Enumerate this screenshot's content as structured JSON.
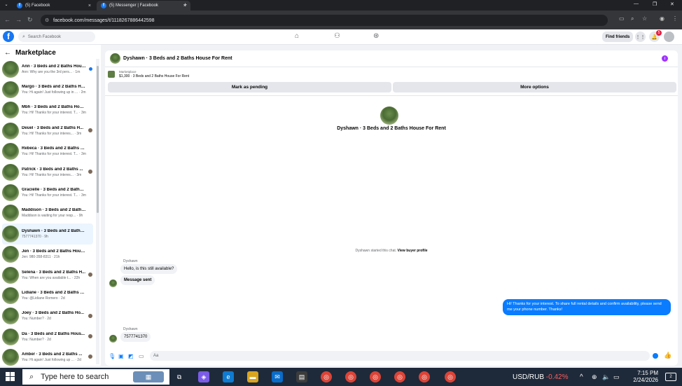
{
  "browser": {
    "tabs": [
      {
        "title": "(5) Facebook",
        "active": false
      },
      {
        "title": "(5) Messenger | Facebook",
        "active": true
      }
    ],
    "url": "facebook.com/messages/t/1118267886442598"
  },
  "fb_header": {
    "search_placeholder": "Search Facebook",
    "find_friends": "Find friends",
    "notification_count": "5"
  },
  "sidebar": {
    "title": "Marketplace",
    "conversations": [
      {
        "name": "Ann · 3 Beds and 2 Baths Hous...",
        "preview": "Ann: Why are you the 3rd pers... · 1m",
        "status": "unread"
      },
      {
        "name": "Margo · 3 Beds and 2 Baths Ho...",
        "preview": "You: Hi again! Just following up in ... · 2m",
        "status": ""
      },
      {
        "name": "Mbh · 3 Beds and 2 Baths Hous...",
        "preview": "You: Hi! Thanks for your interest. T... · 3m",
        "status": ""
      },
      {
        "name": "Deuel · 3 Beds and 2 Baths H...",
        "preview": "You: Hi! Thanks for your interes... · 3m",
        "status": "seen"
      },
      {
        "name": "Rebeca · 3 Beds and 2 Baths Ho...",
        "preview": "You: Hi! Thanks for your interest. T... · 3m",
        "status": ""
      },
      {
        "name": "Patrick · 3 Beds and 2 Baths ...",
        "preview": "You: Hi! Thanks for your interes... · 3m",
        "status": "seen"
      },
      {
        "name": "Gracielle · 3 Beds and 2 Baths H...",
        "preview": "You: Hi! Thanks for your interest. T... · 3m",
        "status": ""
      },
      {
        "name": "Maddison · 3 Beds and 2 Baths ...",
        "preview": "Maddison is waiting for your resp... · 9h",
        "status": ""
      },
      {
        "name": "Dyshawn · 3 Beds and 2 Baths ...",
        "preview": "7577741370 · 9h",
        "status": "active"
      },
      {
        "name": "Jen · 3 Beds and 2 Baths House ...",
        "preview": "Jen: 980-358-8311 · 21h",
        "status": ""
      },
      {
        "name": "Selena · 3 Beds and 2 Baths H...",
        "preview": "You: When are you available t... · 22h",
        "status": "seen"
      },
      {
        "name": "Lidiane · 3 Beds and 2 Baths Ho...",
        "preview": "You: @Lidiane Romero · 2d",
        "status": ""
      },
      {
        "name": "Joey · 3 Beds and 2 Baths Ho...",
        "preview": "You: Number? · 2d",
        "status": "seen"
      },
      {
        "name": "Da · 3 Beds and 2 Baths Hous...",
        "preview": "You: Number? · 2d",
        "status": "seen"
      },
      {
        "name": "Amber · 3 Beds and 2 Baths ...",
        "preview": "You: Hi again! Just following up ... · 2d",
        "status": "seen"
      }
    ]
  },
  "chat": {
    "title": "Dyshawn · 3 Beds and 2 Baths House For Rent",
    "marketplace_label": "Marketplace",
    "listing": "$1,300 · 3 Beds and 2 Baths House For Rent",
    "btn_pending": "Mark as pending",
    "btn_more": "More options",
    "center_title": "Dyshawn · 3 Beds and 2 Baths House For Rent",
    "system_text": "Dyshawn started this chat.",
    "system_link": "View buyer profile",
    "msg1_sender": "Dyshawn",
    "msg1": "Hello, is this still available?",
    "msg2": "Message sent",
    "outgoing": "Hi! Thanks for your interest. To share full rental details and confirm availability, please send me your phone number. Thanks!",
    "msg3_sender": "Dyshawn",
    "msg3": "7577741370",
    "composer_placeholder": "Aa"
  },
  "taskbar": {
    "search_placeholder": "Type here to search",
    "ticker": "USD/RUB",
    "ticker_change": "-0.42%",
    "time": "7:15 PM",
    "date": "2/24/2026",
    "notif_count": "2"
  },
  "colors": {
    "fb_blue": "#1877f2",
    "messenger_blue": "#0a7cff",
    "taskbar": "#1e2a3a"
  }
}
